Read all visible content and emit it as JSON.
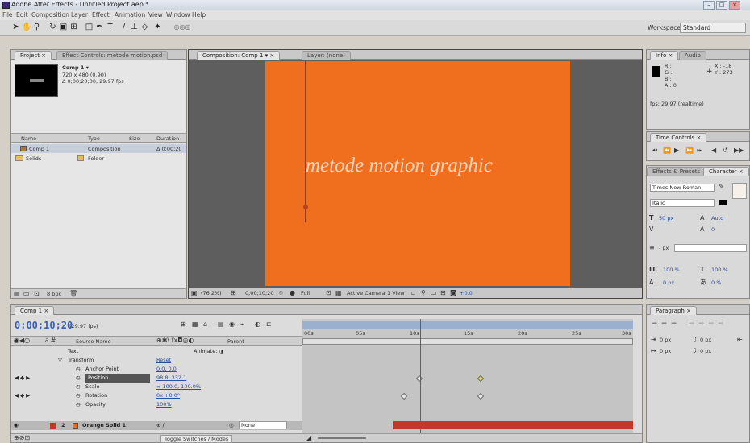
{
  "window": {
    "title": "Adobe After Effects - Untitled Project.aep *"
  },
  "menu": [
    "File",
    "Edit",
    "Composition",
    "Layer",
    "Effect",
    "Animation",
    "View",
    "Window",
    "Help"
  ],
  "workspace": {
    "label": "Workspace:",
    "value": "Standard"
  },
  "project_panel": {
    "tabs": [
      "Project ×",
      "Effect Controls: metode motion.psd"
    ],
    "comp_name": "Comp 1 ▾",
    "comp_size": "720 x 480 (0.90)",
    "comp_duration": "Δ 0;00;20;00, 29.97 fps",
    "columns": [
      "Name",
      "Type",
      "Size",
      "Duration"
    ],
    "items": [
      {
        "name": "Comp 1",
        "type": "Composition",
        "duration": "Δ 0;00;20"
      },
      {
        "name": "Solids",
        "type": "Folder",
        "duration": ""
      }
    ],
    "bpc": "8 bpc"
  },
  "comp_panel": {
    "tabs": [
      "Composition: Comp 1 ▾ ×",
      "Layer: (none)"
    ],
    "text": "metode motion graphic",
    "zoom": "(76.2%)",
    "timecode": "0;00;10;20",
    "resolution": "Full",
    "camera": "Active Camera",
    "view": "1 View",
    "exposure": "+0.0"
  },
  "info_panel": {
    "tabs": [
      "Info ×",
      "Audio"
    ],
    "r": "R :",
    "g": "G :",
    "b": "B :",
    "a": "A : 0",
    "x": "X : -18",
    "y": "Y : 273",
    "fps": "fps: 29.97 (realtime)"
  },
  "time_controls": {
    "tab": "Time Controls ×"
  },
  "character_panel": {
    "tabs": [
      "Effects & Presets",
      "Character ×"
    ],
    "font": "Times New Roman",
    "style": "Italic",
    "size": "50 px",
    "leading": "Auto",
    "tracking": "0",
    "stroke": "- px",
    "vscale": "100 %",
    "hscale": "100 %",
    "baseline": "0 px",
    "tsume": "0 %"
  },
  "paragraph_panel": {
    "tab": "Paragraph ×",
    "indent1": "0 px",
    "indent2": "0 px",
    "indent3": "0 px",
    "space1": "0 px",
    "space2": "0 px"
  },
  "timeline": {
    "tab": "Comp 1 ×",
    "timecode": "0;00;10;20",
    "fps": "(29.97 fps)",
    "col_source": "Source Name",
    "col_parent": "Parent",
    "ruler": [
      "00s",
      "05s",
      "10s",
      "15s",
      "20s",
      "25s",
      "30s"
    ],
    "rows": [
      {
        "label": "Text",
        "value": "",
        "animate": "Animate: ◑"
      },
      {
        "label": "Transform",
        "value": "Reset"
      },
      {
        "label": "Anchor Point",
        "value": "0.0, 0.0"
      },
      {
        "label": "Position",
        "value": "98.8, 332.1"
      },
      {
        "label": "Scale",
        "value": "∞ 100.0, 100.0%"
      },
      {
        "label": "Rotation",
        "value": "0x +0.0°"
      },
      {
        "label": "Opacity",
        "value": "100%"
      }
    ],
    "layer": {
      "num": "2",
      "name": "Orange Solid 1",
      "parent": "None"
    },
    "toggle": "Toggle Switches / Modes"
  }
}
